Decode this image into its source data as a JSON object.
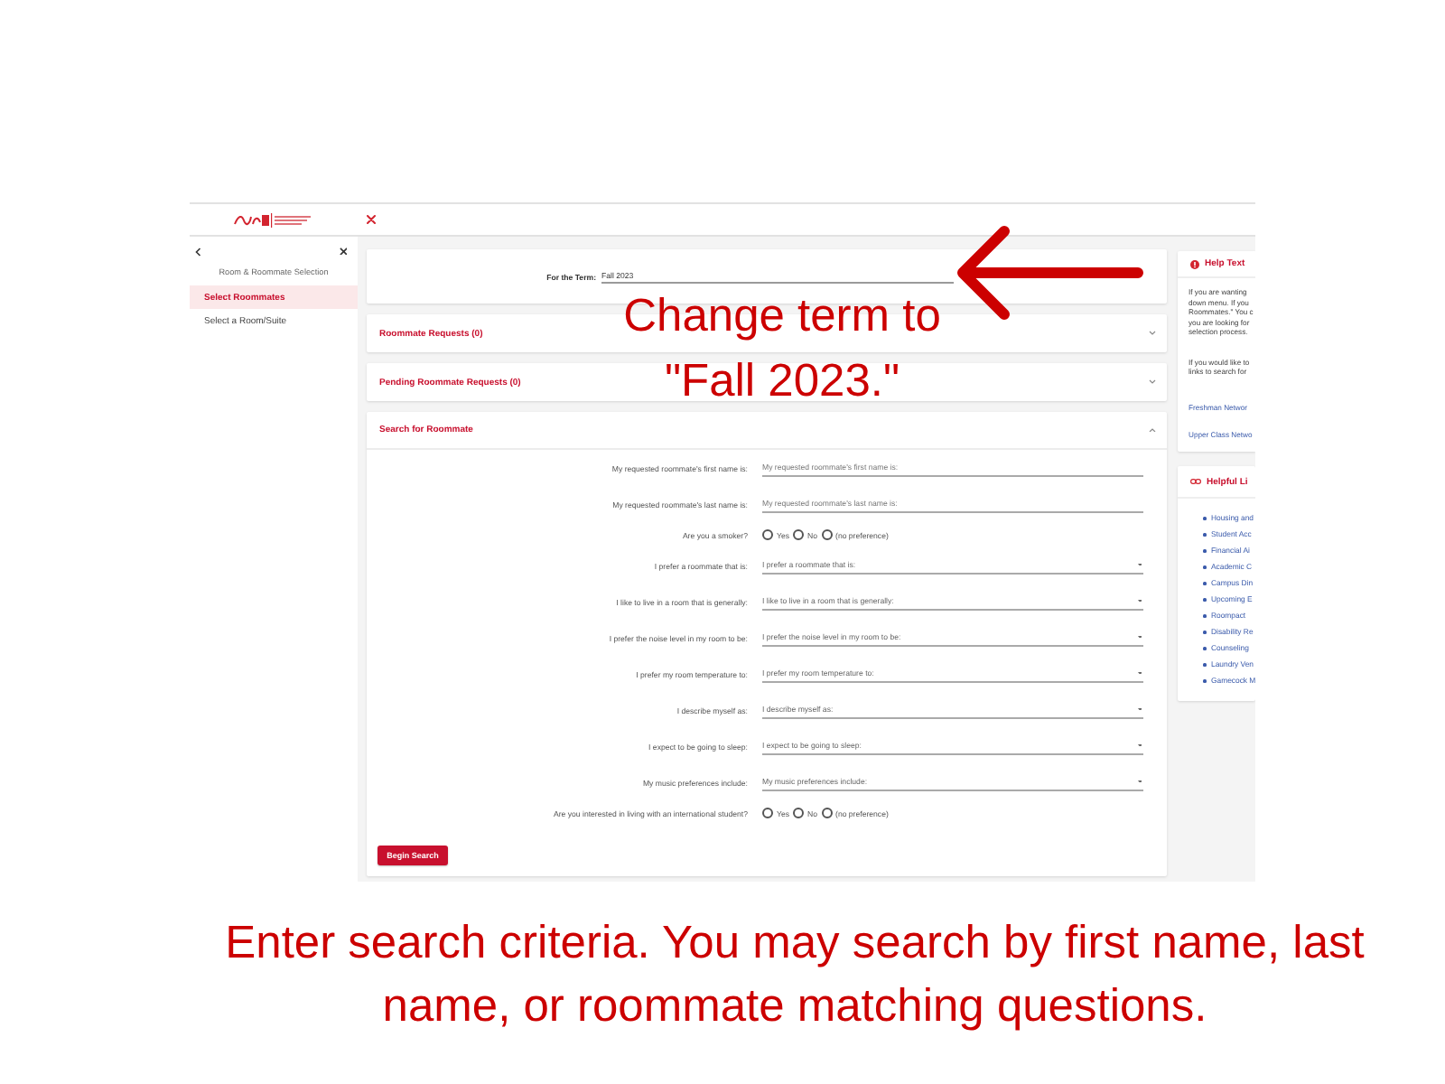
{
  "sidebar": {
    "heading": "Room & Roommate Selection",
    "items": [
      {
        "label": "Select Roommates",
        "selected": true
      },
      {
        "label": "Select a Room/Suite",
        "selected": false
      }
    ]
  },
  "term": {
    "label": "For the Term:",
    "value": "Fall 2023"
  },
  "sections": [
    {
      "title": "Roommate Requests (0)",
      "expanded": false
    },
    {
      "title": "Pending Roommate Requests (0)",
      "expanded": false
    },
    {
      "title": "Search for Roommate",
      "expanded": true,
      "fields": [
        {
          "kind": "text",
          "label": "My requested roommate's first name is:",
          "placeholder": "My requested roommate's first name is:"
        },
        {
          "kind": "text",
          "label": "My requested roommate's last name is:",
          "placeholder": "My requested roommate's last name is:"
        },
        {
          "kind": "radio",
          "label": "Are you a smoker?",
          "options": [
            {
              "label": "Yes",
              "selected": false
            },
            {
              "label": "No",
              "selected": false
            },
            {
              "label": "(no preference)",
              "selected": false
            }
          ]
        },
        {
          "kind": "select",
          "label": "I prefer a roommate that is:",
          "placeholder": "I prefer a roommate that is:"
        },
        {
          "kind": "select",
          "label": "I like to live in a room that is generally:",
          "placeholder": "I like to live in a room that is generally:"
        },
        {
          "kind": "select",
          "label": "I prefer the noise level in my room to be:",
          "placeholder": "I prefer the noise level in my room to be:"
        },
        {
          "kind": "select",
          "label": "I prefer my room temperature to:",
          "placeholder": "I prefer my room temperature to:"
        },
        {
          "kind": "select",
          "label": "I describe myself as:",
          "placeholder": "I describe myself as:"
        },
        {
          "kind": "select",
          "label": "I expect to be going to sleep:",
          "placeholder": "I expect to be going to sleep:"
        },
        {
          "kind": "select",
          "label": "My music preferences include:",
          "placeholder": "My music preferences include:"
        },
        {
          "kind": "radio",
          "label": "Are you interested in living with an international student?",
          "options": [
            {
              "label": "Yes",
              "selected": false
            },
            {
              "label": "No",
              "selected": false
            },
            {
              "label": "(no preference)",
              "selected": false
            }
          ]
        }
      ],
      "button": "Begin Search"
    }
  ],
  "help_text": {
    "title": "Help Text",
    "paragraphs": [
      [
        "If you are wanting",
        "down menu. If you",
        "Roommates.\" You c",
        "you are looking for",
        "selection process."
      ],
      [
        "If you would like to",
        "links to search for"
      ]
    ],
    "links": [
      "Freshman Networ",
      "Upper Class Netwo"
    ]
  },
  "helpful_links": {
    "title": "Helpful Li",
    "items": [
      "Housing and",
      "Student Acc",
      "Financial Ai",
      "Academic C",
      "Campus Din",
      "Upcoming E",
      "Roompact",
      "Disability Re",
      "Counseling",
      "Laundry Ven",
      "Gamecock M"
    ]
  },
  "annotations": {
    "callout": "Change term to \"Fall 2023.\"",
    "caption": "Enter search criteria. You may search by first name, last name, or roommate matching questions."
  }
}
